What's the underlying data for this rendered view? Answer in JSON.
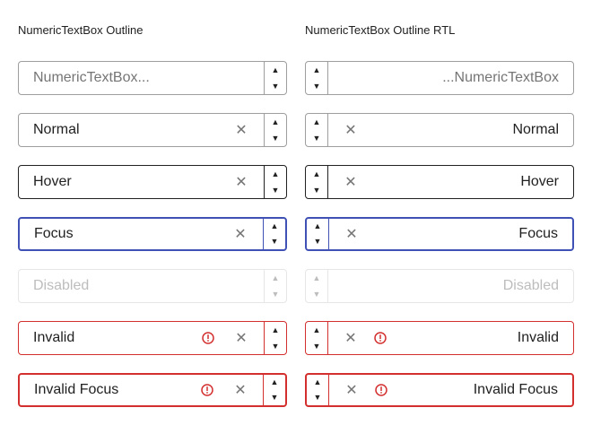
{
  "columns": {
    "ltr": {
      "title": "NumericTextBox Outline"
    },
    "rtl": {
      "title": "NumericTextBox Outline RTL"
    }
  },
  "fields": {
    "placeholder": "NumericTextBox...",
    "rtl_placeholder": "...NumericTextBox",
    "normal": "Normal",
    "hover": "Hover",
    "focus": "Focus",
    "disabled": "Disabled",
    "invalid": "Invalid",
    "invalid_focus": "Invalid Focus"
  },
  "icons": {
    "spin_up": "▲",
    "spin_down": "▼",
    "clear": "✕",
    "error": "error-circle-icon",
    "spin_up_icon": "caret-up-icon",
    "spin_down_icon": "caret-down-icon",
    "clear_icon": "clear-icon"
  },
  "colors": {
    "border": "#9e9e9e",
    "hover_border": "#212121",
    "focus_border": "#3f51b5",
    "disabled_border": "#e6e6e6",
    "invalid_border": "#d32f2f"
  }
}
